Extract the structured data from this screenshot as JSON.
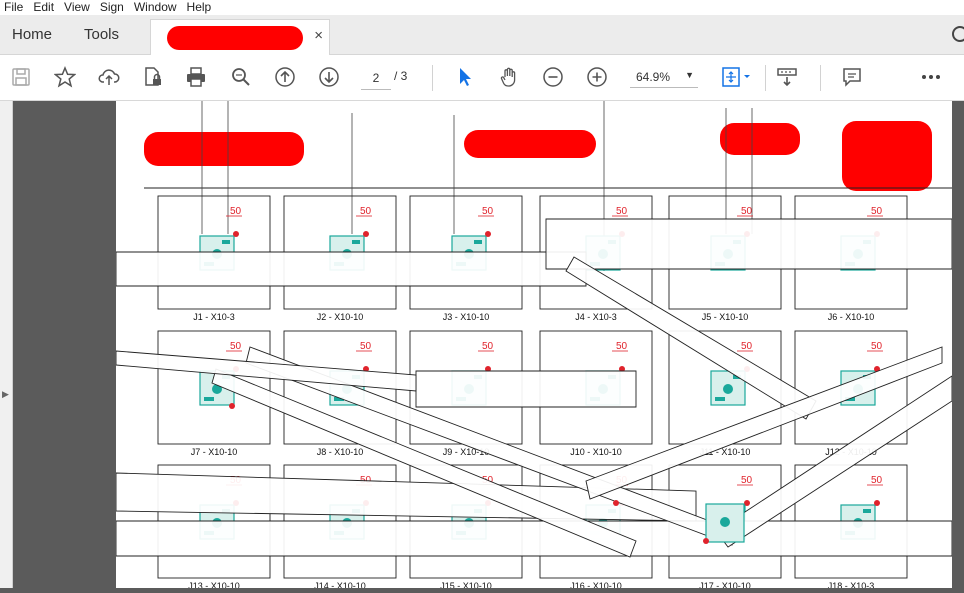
{
  "menu": [
    "File",
    "Edit",
    "View",
    "Sign",
    "Window",
    "Help"
  ],
  "tabs": {
    "home": "Home",
    "tools": "Tools",
    "close": "×"
  },
  "toolbar": {
    "page_current": "2",
    "page_total": "/ 3",
    "zoom": "64.9%"
  },
  "icons": [
    "save-icon",
    "bookmark-star-icon",
    "upload-cloud-icon",
    "protect-file-icon",
    "print-icon",
    "zoom-search-icon",
    "page-up-icon",
    "page-down-icon",
    "select-cursor-icon",
    "hand-tool-icon",
    "zoom-out-icon",
    "zoom-in-icon",
    "fit-page-icon",
    "scroll-mode-icon",
    "comment-icon",
    "more-icon"
  ],
  "colors": {
    "teal": "#1aa89b",
    "annotation_red": "#e0232c",
    "redaction": "#ff0000"
  },
  "drawing": {
    "row1": [
      "J1 - X10-3",
      "J2 - X10-10",
      "J3 - X10-10",
      "J4 - X10-3",
      "J5 - X10-10",
      "J6 - X10-10"
    ],
    "row2": [
      "J7 - X10-10",
      "J8 - X10-10",
      "J9 - X10-10",
      "J10 - X10-10",
      "J11 - X10-10",
      "J12 - X10-10"
    ],
    "row3": [
      "J13 - X10-10",
      "J14 - X10-10",
      "J15 - X10-10",
      "J16 - X10-10",
      "J17 - X10-10",
      "J18 - X10-3"
    ],
    "dim": "50"
  }
}
